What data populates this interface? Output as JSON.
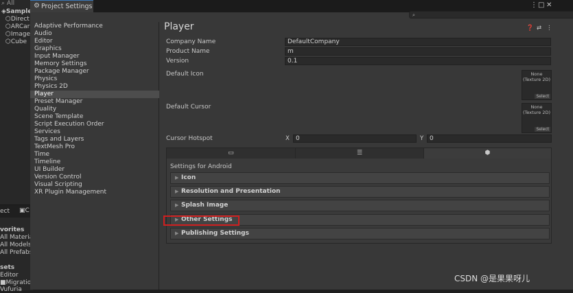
{
  "background": {
    "hierarchy_filter": "All",
    "hierarchy_items": [
      "SampleS",
      "Direct",
      "ARCar",
      "Image",
      "Cube"
    ],
    "project_tabs": [
      "ect",
      "C"
    ],
    "favorites_header": "vorites",
    "favorites": [
      "All Material",
      "All Models",
      "All Prefabs"
    ],
    "assets_header": "sets",
    "assets": [
      "Editor",
      "Migratio",
      "Vufuria"
    ]
  },
  "window": {
    "title": "Project Settings",
    "title_icon": "gear-icon",
    "window_controls": [
      "more-icon",
      "maximize-icon",
      "close-icon"
    ],
    "search_placeholder": ""
  },
  "categories": [
    {
      "label": "Adaptive Performance"
    },
    {
      "label": "Audio"
    },
    {
      "label": "Editor"
    },
    {
      "label": "Graphics"
    },
    {
      "label": "Input Manager"
    },
    {
      "label": "Memory Settings"
    },
    {
      "label": "Package Manager"
    },
    {
      "label": "Physics"
    },
    {
      "label": "Physics 2D"
    },
    {
      "label": "Player",
      "selected": true
    },
    {
      "label": "Preset Manager"
    },
    {
      "label": "Quality"
    },
    {
      "label": "Scene Template"
    },
    {
      "label": "Script Execution Order"
    },
    {
      "label": "Services"
    },
    {
      "label": "Tags and Layers"
    },
    {
      "label": "TextMesh Pro"
    },
    {
      "label": "Time"
    },
    {
      "label": "Timeline"
    },
    {
      "label": "UI Builder"
    },
    {
      "label": "Version Control"
    },
    {
      "label": "Visual Scripting"
    },
    {
      "label": "XR Plugin Management"
    }
  ],
  "player": {
    "title": "Player",
    "header_icons": [
      "help-icon",
      "preset-icon",
      "more-icon"
    ],
    "company_name_label": "Company Name",
    "company_name": "DefaultCompany",
    "product_name_label": "Product Name",
    "product_name": "m",
    "version_label": "Version",
    "version": "0.1",
    "default_icon_label": "Default Icon",
    "default_icon_none": "None",
    "default_icon_type": "(Texture 2D)",
    "default_icon_select": "Select",
    "default_cursor_label": "Default Cursor",
    "default_cursor_none": "None",
    "default_cursor_type": "(Texture 2D)",
    "default_cursor_select": "Select",
    "cursor_hotspot_label": "Cursor Hotspot",
    "hotspot_x_label": "X",
    "hotspot_x": "0",
    "hotspot_y_label": "Y",
    "hotspot_y": "0",
    "platform_tabs": [
      {
        "icon": "monitor-icon"
      },
      {
        "icon": "webgl-icon"
      },
      {
        "icon": "android-icon",
        "active": true
      }
    ],
    "settings_for": "Settings for Android",
    "sections": [
      "Icon",
      "Resolution and Presentation",
      "Splash Image",
      "Other Settings",
      "Publishing Settings"
    ]
  },
  "highlight_color": "#d01f1f",
  "watermark": "CSDN @是果果呀儿"
}
